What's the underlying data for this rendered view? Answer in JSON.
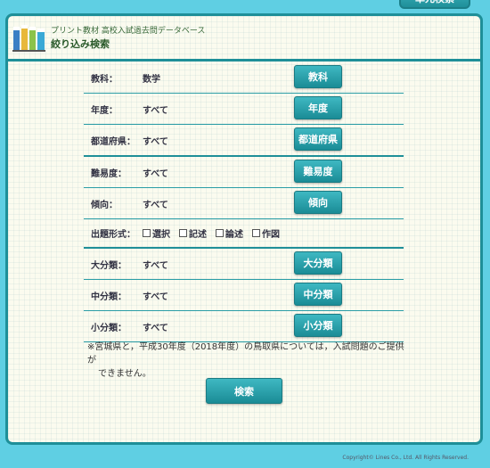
{
  "top_tab": {
    "label": "単元検索"
  },
  "header": {
    "subtitle": "プリント教材 高校入試過去問データベース",
    "title": "絞り込み検索"
  },
  "rows": [
    {
      "label": "教科：",
      "value": "数学",
      "button": "教科"
    },
    {
      "label": "年度：",
      "value": "すべて",
      "button": "年度"
    },
    {
      "label": "都道府県：",
      "value": "すべて",
      "button": "都道府県"
    },
    {
      "label": "難易度：",
      "value": "すべて",
      "button": "難易度"
    },
    {
      "label": "傾向：",
      "value": "すべて",
      "button": "傾向"
    },
    {
      "label": "大分類：",
      "value": "すべて",
      "button": "大分類"
    },
    {
      "label": "中分類：",
      "value": "すべて",
      "button": "中分類"
    },
    {
      "label": "小分類：",
      "value": "すべて",
      "button": "小分類"
    }
  ],
  "format_row": {
    "label": "出題形式：",
    "options": [
      "選択",
      "記述",
      "論述",
      "作図"
    ]
  },
  "note": {
    "line1": "※宮城県と，平成30年度（2018年度）の鳥取県については，入試問題のご提供が",
    "line2": "できません。"
  },
  "search_button": "検索",
  "copyright": "Copyright© Lines Co., Ltd. All Rights Reserved.",
  "colors": {
    "accent": "#1e8f98",
    "background": "#5fcfe3",
    "panel": "#fbfbef"
  }
}
